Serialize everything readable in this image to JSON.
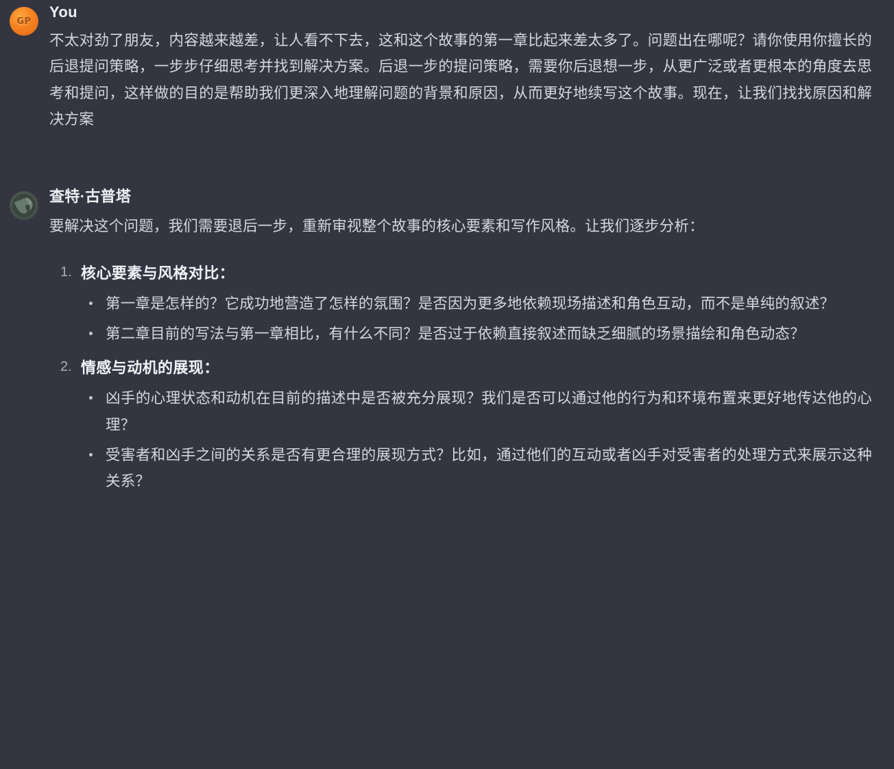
{
  "theme": {
    "background": "#343541",
    "text_color": "#d3d7de",
    "heading_color": "#f0f2f5",
    "user_avatar_color": "#f58220",
    "assistant_avatar_color": "#3d4a43"
  },
  "messages": {
    "user": {
      "avatar_initials": "GP",
      "author": "You",
      "body": "不太对劲了朋友，内容越来越差，让人看不下去，这和这个故事的第一章比起来差太多了。问题出在哪呢？请你使用你擅长的后退提问策略，一步步仔细思考并找到解决方案。后退一步的提问策略，需要你后退想一步，从更广泛或者更根本的角度去思考和提问，这样做的目的是帮助我们更深入地理解问题的背景和原因，从而更好地续写这个故事。现在，让我们找找原因和解决方案"
    },
    "assistant": {
      "avatar_icon": "globe-avatar-icon",
      "author": "查特·古普塔",
      "intro": "要解决这个问题，我们需要退后一步，重新审视整个故事的核心要素和写作风格。让我们逐步分析：",
      "steps": [
        {
          "number": "1.",
          "title": "核心要素与风格对比：",
          "bullets": [
            "第一章是怎样的？它成功地营造了怎样的氛围？是否因为更多地依赖现场描述和角色互动，而不是单纯的叙述？",
            "第二章目前的写法与第一章相比，有什么不同？是否过于依赖直接叙述而缺乏细腻的场景描绘和角色动态？"
          ]
        },
        {
          "number": "2.",
          "title": "情感与动机的展现：",
          "bullets": [
            "凶手的心理状态和动机在目前的描述中是否被充分展现？我们是否可以通过他的行为和环境布置来更好地传达他的心理？",
            "受害者和凶手之间的关系是否有更合理的展现方式？比如，通过他们的互动或者凶手对受害者的处理方式来展示这种关系？"
          ]
        }
      ]
    }
  }
}
